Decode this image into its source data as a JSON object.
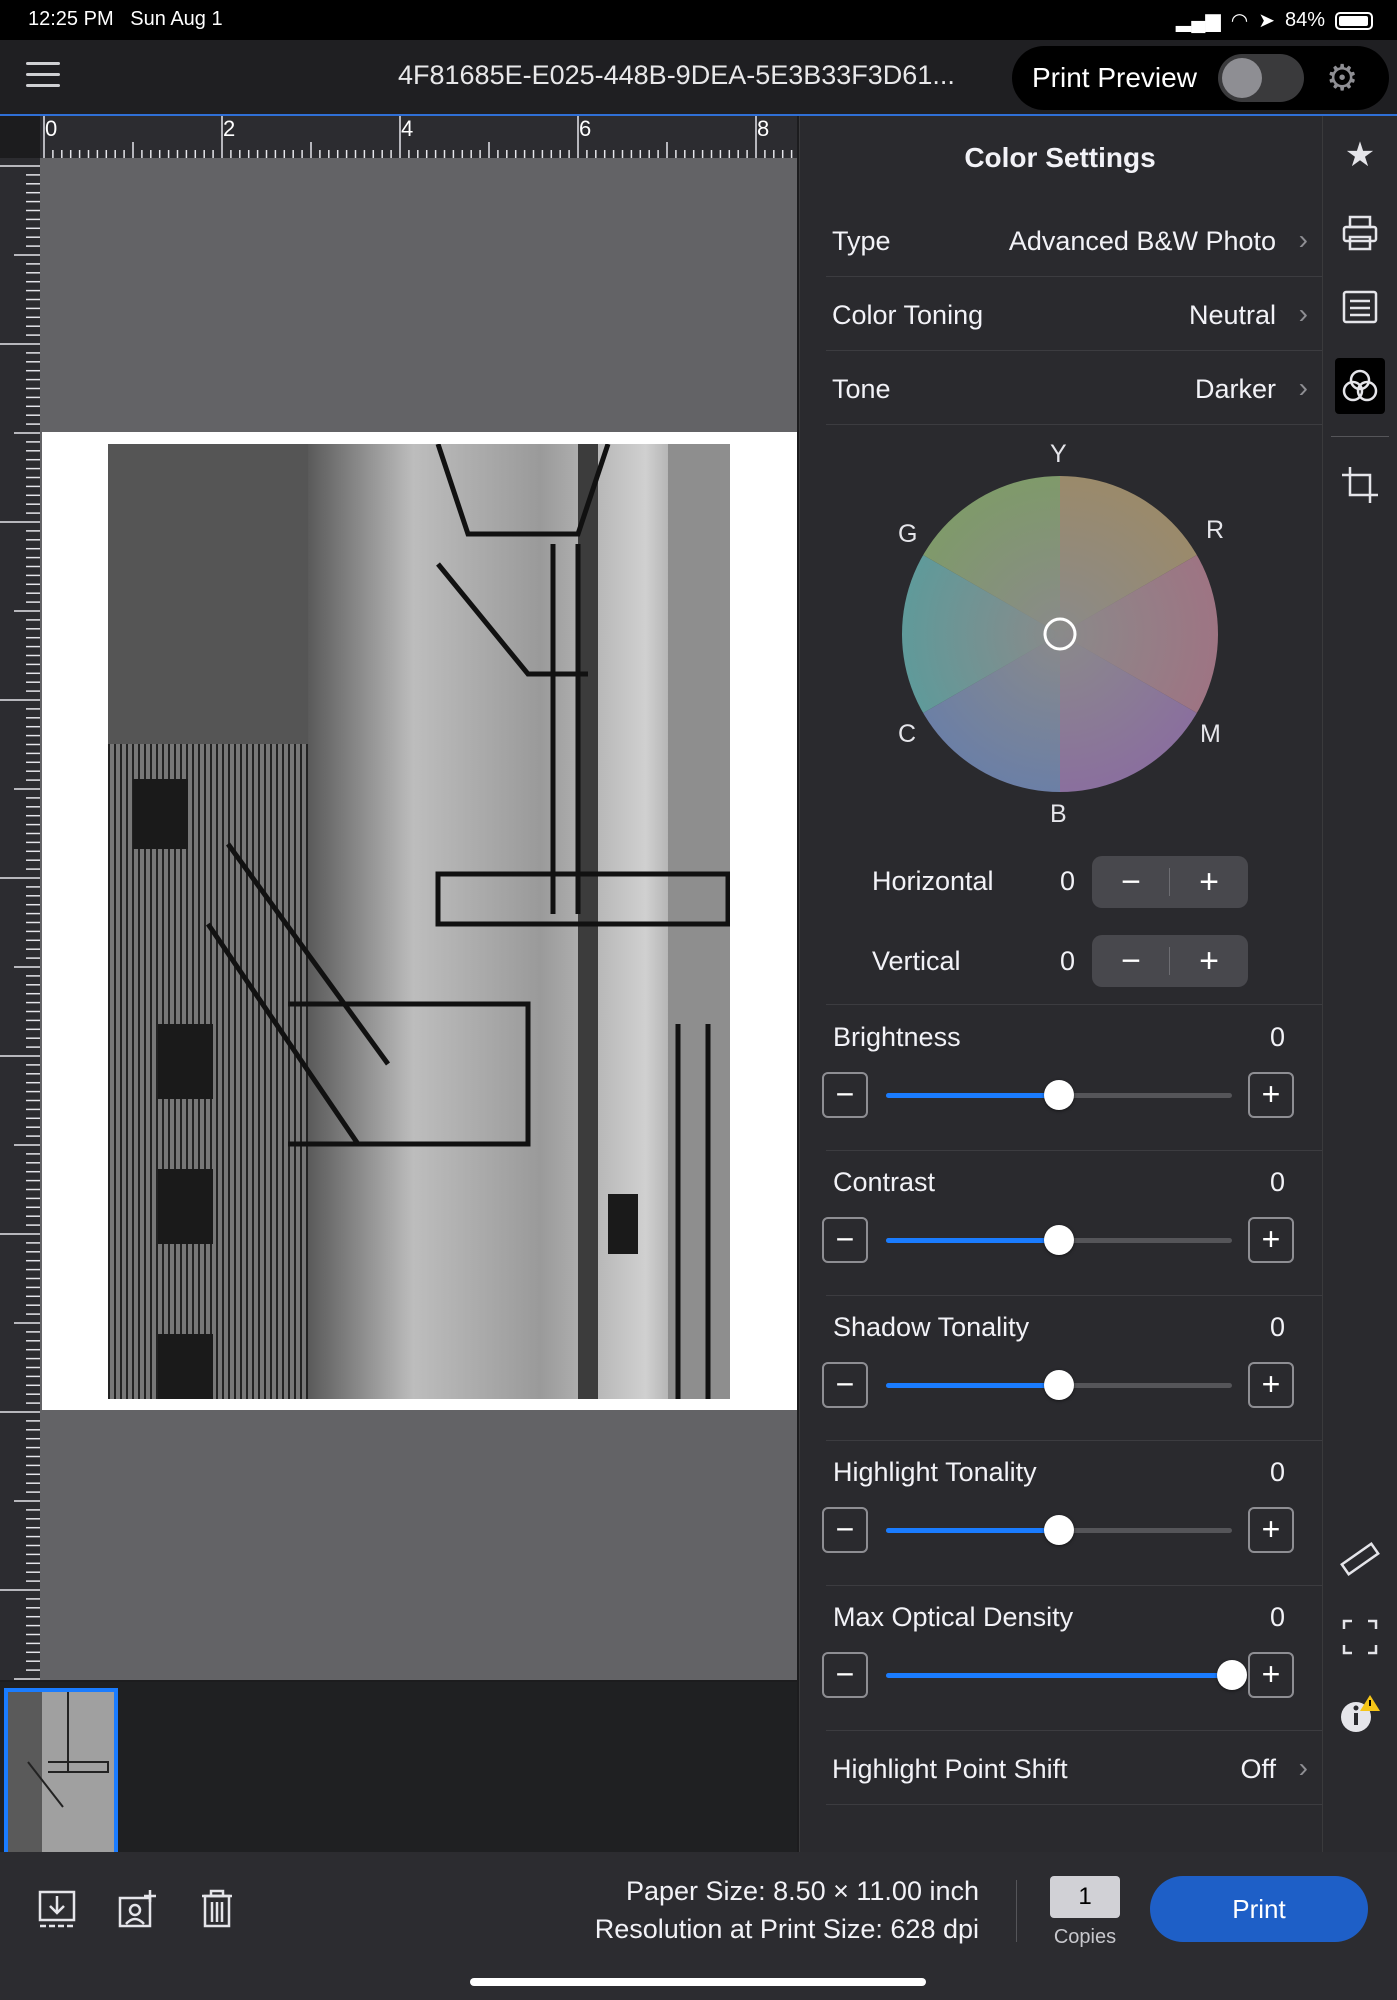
{
  "status": {
    "time": "12:25 PM",
    "date": "Sun Aug 1",
    "battery": "84%"
  },
  "header": {
    "filename": "4F81685E-E025-448B-9DEA-5E3B33F3D61...",
    "print_preview_label": "Print Preview",
    "print_preview_on": false
  },
  "ruler": {
    "top_labels": [
      "0",
      "2",
      "4",
      "6",
      "8"
    ]
  },
  "panel": {
    "title": "Color Settings",
    "rows": [
      {
        "label": "Type",
        "value": "Advanced B&W Photo"
      },
      {
        "label": "Color Toning",
        "value": "Neutral"
      },
      {
        "label": "Tone",
        "value": "Darker"
      }
    ],
    "wheel_labels": {
      "top": "Y",
      "top_right": "R",
      "top_left": "G",
      "bottom_left": "C",
      "bottom_right": "M",
      "bottom": "B"
    },
    "horizontal": {
      "label": "Horizontal",
      "value": "0"
    },
    "vertical": {
      "label": "Vertical",
      "value": "0"
    },
    "sliders": [
      {
        "label": "Brightness",
        "value": "0",
        "level": 0.5
      },
      {
        "label": "Contrast",
        "value": "0",
        "level": 0.5
      },
      {
        "label": "Shadow Tonality",
        "value": "0",
        "level": 0.5
      },
      {
        "label": "Highlight Tonality",
        "value": "0",
        "level": 0.5
      },
      {
        "label": "Max Optical Density",
        "value": "0",
        "level": 1.0
      }
    ],
    "highlight_shift": {
      "label": "Highlight Point Shift",
      "value": "Off"
    }
  },
  "bottom": {
    "paper_size": "Paper Size:  8.50 × 11.00 inch",
    "resolution": "Resolution at Print Size:  628 dpi",
    "copies_value": "1",
    "copies_label": "Copies",
    "print_label": "Print"
  },
  "colors": {
    "accent": "#1a7cff",
    "print_button": "#1e5fc7",
    "panel_bg": "#2a2a2e",
    "canvas_bg": "#636366"
  },
  "icons": {
    "sidebar": [
      "star-icon",
      "printer-icon",
      "settings-list-icon",
      "color-settings-icon",
      "crop-icon",
      "ruler-icon",
      "expand-icon",
      "info-warning-icon"
    ],
    "bottom": [
      "import-icon",
      "add-photo-icon",
      "trash-icon"
    ]
  }
}
